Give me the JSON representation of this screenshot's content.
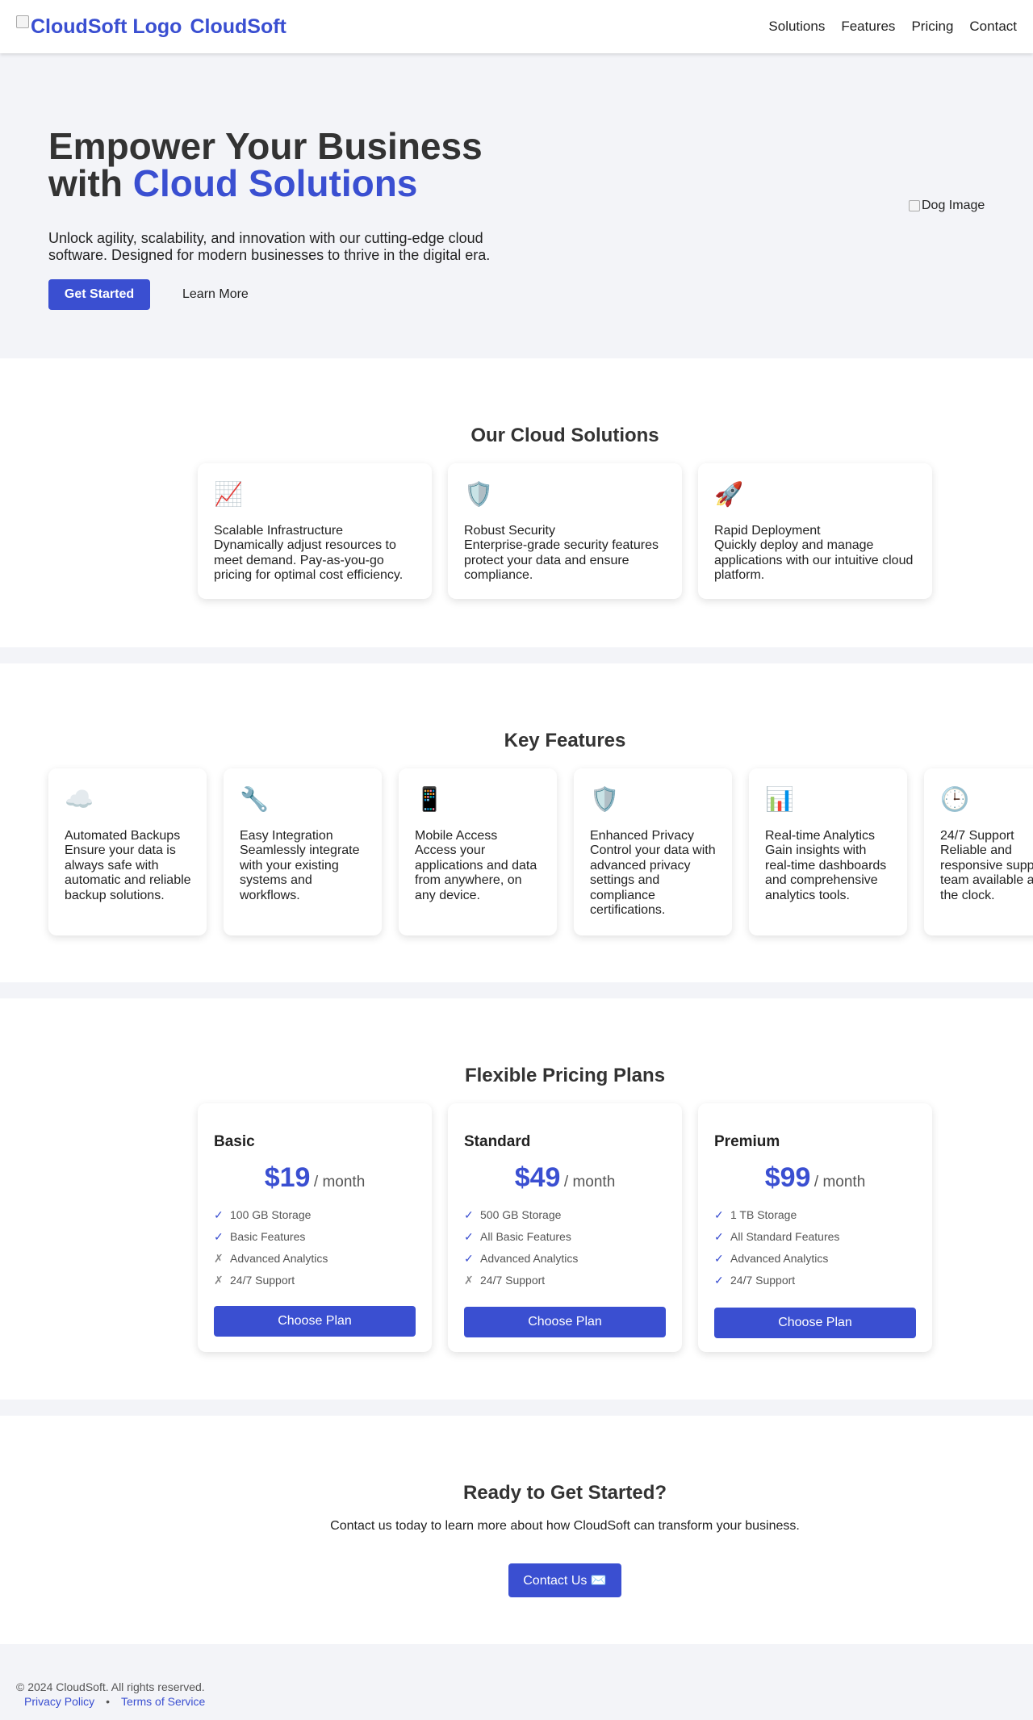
{
  "header": {
    "logo_alt": "CloudSoft Logo",
    "brand": "CloudSoft",
    "nav": [
      "Solutions",
      "Features",
      "Pricing",
      "Contact"
    ]
  },
  "hero": {
    "title_line1": "Empower Your Business",
    "title_with": "with ",
    "title_accent": "Cloud Solutions",
    "subtitle": "Unlock agility, scalability, and innovation with our cutting-edge cloud software. Designed for modern businesses to thrive in the digital era.",
    "primary_button": "Get Started",
    "secondary_button": "Learn More",
    "image_alt": "Dog Image"
  },
  "solutions": {
    "title": "Our Cloud Solutions",
    "items": [
      {
        "icon": "📈",
        "icon_name": "chart-increasing-icon",
        "title": "Scalable Infrastructure",
        "desc": "Dynamically adjust resources to meet demand. Pay-as-you-go pricing for optimal cost efficiency."
      },
      {
        "icon": "🛡️",
        "icon_name": "shield-icon",
        "title": "Robust Security",
        "desc": "Enterprise-grade security features protect your data and ensure compliance."
      },
      {
        "icon": "🚀",
        "icon_name": "rocket-icon",
        "title": "Rapid Deployment",
        "desc": "Quickly deploy and manage applications with our intuitive cloud platform."
      }
    ]
  },
  "features": {
    "title": "Key Features",
    "items": [
      {
        "icon": "☁️",
        "icon_name": "cloud-icon",
        "title": "Automated Backups",
        "desc": "Ensure your data is always safe with automatic and reliable backup solutions."
      },
      {
        "icon": "🔧",
        "icon_name": "wrench-icon",
        "title": "Easy Integration",
        "desc": "Seamlessly integrate with your existing systems and workflows."
      },
      {
        "icon": "📱",
        "icon_name": "mobile-phone-icon",
        "title": "Mobile Access",
        "desc": "Access your applications and data from anywhere, on any device."
      },
      {
        "icon": "🛡️",
        "icon_name": "shield-icon",
        "title": "Enhanced Privacy",
        "desc": "Control your data with advanced privacy settings and compliance certifications."
      },
      {
        "icon": "📊",
        "icon_name": "bar-chart-icon",
        "title": "Real-time Analytics",
        "desc": "Gain insights with real-time dashboards and comprehensive analytics tools."
      },
      {
        "icon": "🕒",
        "icon_name": "clock-icon",
        "title": "24/7 Support",
        "desc": "Reliable and responsive support team available around the clock."
      }
    ]
  },
  "pricing": {
    "title": "Flexible Pricing Plans",
    "per": "/ month",
    "button": "Choose Plan",
    "check": "✓",
    "cross": "✗",
    "plans": [
      {
        "name": "Basic",
        "price": "$19",
        "features": [
          {
            "text": "100 GB Storage",
            "included": true
          },
          {
            "text": "Basic Features",
            "included": true
          },
          {
            "text": "Advanced Analytics",
            "included": false
          },
          {
            "text": "24/7 Support",
            "included": false
          }
        ]
      },
      {
        "name": "Standard",
        "price": "$49",
        "features": [
          {
            "text": "500 GB Storage",
            "included": true
          },
          {
            "text": "All Basic Features",
            "included": true
          },
          {
            "text": "Advanced Analytics",
            "included": true
          },
          {
            "text": "24/7 Support",
            "included": false
          }
        ]
      },
      {
        "name": "Premium",
        "price": "$99",
        "features": [
          {
            "text": "1 TB Storage",
            "included": true
          },
          {
            "text": "All Standard Features",
            "included": true
          },
          {
            "text": "Advanced Analytics",
            "included": true
          },
          {
            "text": "24/7 Support",
            "included": true
          }
        ]
      }
    ]
  },
  "cta": {
    "title": "Ready to Get Started?",
    "subtitle": "Contact us today to learn more about how CloudSoft can transform your business.",
    "button": "Contact Us ✉️"
  },
  "footer": {
    "copyright": "© 2024 CloudSoft. All rights reserved.",
    "links": [
      "Privacy Policy",
      "Terms of Service"
    ],
    "separator": "•"
  },
  "colors": {
    "accent": "#3a4fd1",
    "background": "#f3f4f8",
    "text": "#333333"
  }
}
